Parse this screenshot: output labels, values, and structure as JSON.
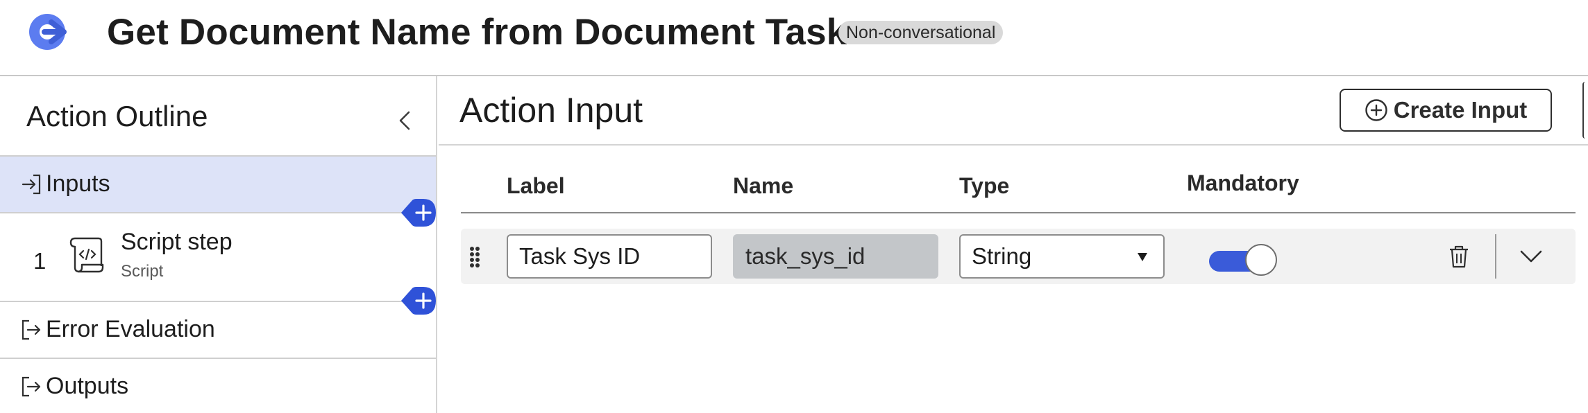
{
  "header": {
    "title": "Get Document Name from Document Task",
    "badge": "Non-conversational",
    "app_icon": "arrow-circle-logo-icon"
  },
  "outline": {
    "title": "Action Outline",
    "collapse_icon": "chevron-left-icon",
    "items": [
      {
        "label": "Inputs",
        "icon": "input-arrow-icon",
        "active": true
      },
      {
        "index": "1",
        "label": "Script step",
        "sublabel": "Script",
        "icon": "script-scroll-icon"
      },
      {
        "label": "Error Evaluation",
        "icon": "output-arrow-icon"
      },
      {
        "label": "Outputs",
        "icon": "output-arrow-icon"
      }
    ],
    "add_icon": "plus-icon"
  },
  "action_input": {
    "title": "Action Input",
    "create_label": "Create Input",
    "columns": [
      "Label",
      "Name",
      "Type",
      "Mandatory"
    ],
    "rows": [
      {
        "label": "Task Sys ID",
        "name": "task_sys_id",
        "type": "String",
        "mandatory": true
      }
    ]
  },
  "colors": {
    "accent": "#3a5bd9",
    "active_bg": "#dde3f8",
    "readonly_bg": "#c3c6c9",
    "badge_bg": "#d9d9d9"
  }
}
